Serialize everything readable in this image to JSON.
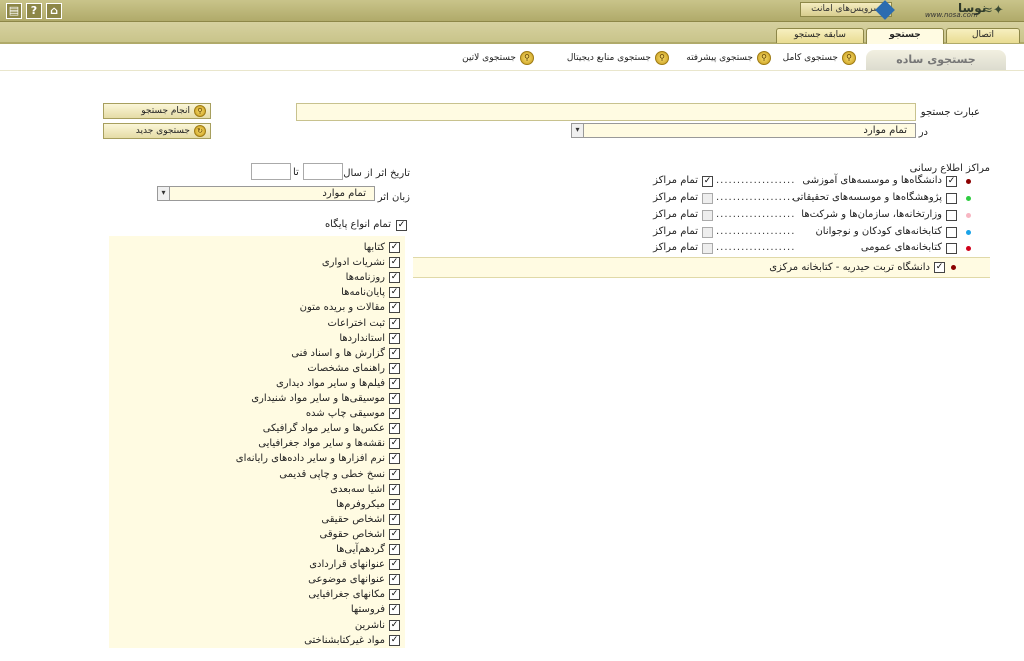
{
  "topbar": {
    "amanat_label": "سرویس‌های امانت",
    "logo_text": "نوسا",
    "logo_url": "www.nosa.com",
    "icons": [
      "home-icon",
      "help-icon",
      "settings-icon"
    ]
  },
  "tabs": [
    {
      "label": "اتصال",
      "active": false
    },
    {
      "label": "جستجو",
      "active": true
    },
    {
      "label": "سابقه جستجو",
      "active": false
    }
  ],
  "subtabs": {
    "active": "جستجوی ساده",
    "items": [
      "جستجوی کامل",
      "جستجوی پیشرفته",
      "جستجوی منابع دیجیتال",
      "جستجوی لاتین"
    ]
  },
  "form": {
    "search_label": "عبارت جستجو",
    "in_label": "در",
    "in_value": "تمام موارد",
    "search_button": "انجام جستجو",
    "new_search_button": "جستجوی جدید",
    "date_label": "تاریخ اثر از سال",
    "date_to": "تا",
    "lang_label": "زبان اثر",
    "lang_value": "تمام موارد",
    "all_types_label": "تمام انواع پایگاه"
  },
  "centers": {
    "title": "مراکز اطلاع رسانی",
    "all_centers_label": "تمام مراکز",
    "rows": [
      {
        "label": "دانشگاه‌ها و موسسه‌های آموزشی",
        "checked": true,
        "all_checked": true,
        "all_enabled": true,
        "dot_color": "#8b0000"
      },
      {
        "label": "پژوهشگاه‌ها و موسسه‌های تحقیقاتی",
        "checked": false,
        "all_checked": false,
        "all_enabled": false,
        "dot_color": "#2ecc40"
      },
      {
        "label": "وزارتخانه‌ها، سازمان‌ها و شرکت‌ها",
        "checked": false,
        "all_checked": false,
        "all_enabled": false,
        "dot_color": "#f7b6c2"
      },
      {
        "label": "کتابخانه‌های کودکان و نوجوانان",
        "checked": false,
        "all_checked": false,
        "all_enabled": false,
        "dot_color": "#1aa3e8"
      },
      {
        "label": "کتابخانه‌های عمومی",
        "checked": false,
        "all_checked": false,
        "all_enabled": false,
        "dot_color": "#d0021b"
      }
    ],
    "selected": {
      "label": "دانشگاه تربت حیدریه - کتابخانه مرکزی",
      "checked": true,
      "dot_color": "#8b0000"
    }
  },
  "types": [
    "کتابها",
    "نشریات ادواری",
    "روزنامه‌ها",
    "پایان‌نامه‌ها",
    "مقالات و بریده متون",
    "ثبت اختراعات",
    "استانداردها",
    "گزارش ها و اسناد فنی",
    "راهنمای مشخصات",
    "فیلم‌ها و سایر مواد دیداری",
    "موسیقی‌ها و سایر مواد شنیداری",
    "موسیقی چاپ شده",
    "عکس‌ها و سایر مواد گرافیکی",
    "نقشه‌ها و سایر مواد جغرافیایی",
    "نرم افزارها و سایر داده‌های رایانه‌ای",
    "نسخ خطی و چاپی قدیمی",
    "اشیا سه‌بعدی",
    "میکروفرم‌ها",
    "اشخاص حقیقی",
    "اشخاص حقوقی",
    "گردهم‌آیی‌ها",
    "عنوانهای قراردادی",
    "عنوانهای موضوعی",
    "مکانهای جغرافیایی",
    "فروستها",
    "ناشرین",
    "مواد غیرکتابشناختی"
  ]
}
